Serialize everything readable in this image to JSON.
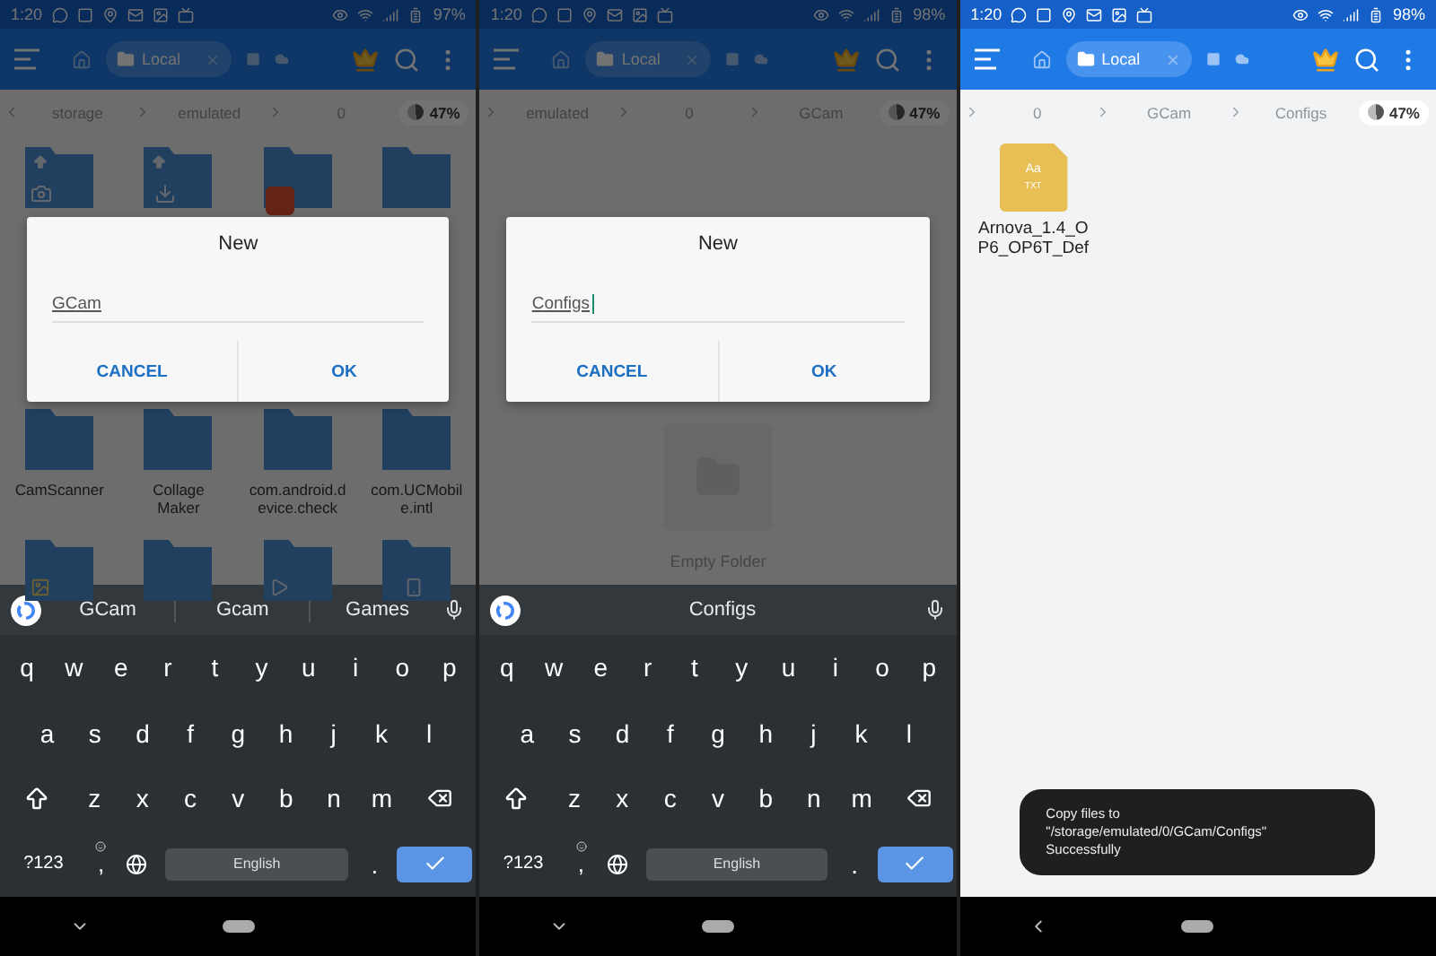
{
  "screens": [
    {
      "dimmed": true,
      "status_bar": {
        "time": "1:20",
        "battery": "97%"
      },
      "app_bar": {
        "tab": "Local"
      },
      "breadcrumbs": [
        "storage",
        "emulated",
        "0"
      ],
      "storage": "47%",
      "content": {
        "kind": "grid",
        "items": [
          {
            "kind": "camera"
          },
          {
            "kind": "download"
          },
          {
            "kind": "app"
          },
          {
            "kind": "plain"
          },
          {
            "kind": "plain",
            "name": "CamScanner"
          },
          {
            "kind": "plain",
            "name": "Collage Maker"
          },
          {
            "kind": "plain",
            "name": "com.android.device.check"
          },
          {
            "kind": "plain",
            "name": "com.UCMobile.intl"
          },
          {
            "kind": "photo"
          },
          {
            "kind": "plain"
          },
          {
            "kind": "video"
          },
          {
            "kind": "phone"
          }
        ]
      },
      "dialog": {
        "title": "New",
        "value": "GCam",
        "cursor": false,
        "buttons": [
          "CANCEL",
          "OK"
        ]
      },
      "keyboard": {
        "suggestions": [
          "GCam",
          "Gcam",
          "Games"
        ],
        "rows": [
          [
            "q",
            "w",
            "e",
            "r",
            "t",
            "y",
            "u",
            "i",
            "o",
            "p"
          ],
          [
            "a",
            "s",
            "d",
            "f",
            "g",
            "h",
            "j",
            "k",
            "l"
          ],
          [
            "z",
            "x",
            "c",
            "v",
            "b",
            "n",
            "m"
          ]
        ],
        "symbols": "?123",
        "comma": ",",
        "space": "English",
        "period": "."
      }
    },
    {
      "dimmed": true,
      "status_bar": {
        "time": "1:20",
        "battery": "98%"
      },
      "app_bar": {
        "tab": "Local"
      },
      "breadcrumbs": [
        "emulated",
        "0",
        "GCam"
      ],
      "storage": "47%",
      "content": {
        "kind": "empty",
        "message": "Empty Folder"
      },
      "dialog": {
        "title": "New",
        "value": "Configs",
        "cursor": true,
        "buttons": [
          "CANCEL",
          "OK"
        ]
      },
      "keyboard": {
        "suggestions": [
          "Configs"
        ],
        "rows": [
          [
            "q",
            "w",
            "e",
            "r",
            "t",
            "y",
            "u",
            "i",
            "o",
            "p"
          ],
          [
            "a",
            "s",
            "d",
            "f",
            "g",
            "h",
            "j",
            "k",
            "l"
          ],
          [
            "z",
            "x",
            "c",
            "v",
            "b",
            "n",
            "m"
          ]
        ],
        "symbols": "?123",
        "comma": ",",
        "space": "English",
        "period": "."
      }
    },
    {
      "dimmed": false,
      "status_bar": {
        "time": "1:20",
        "battery": "98%"
      },
      "app_bar": {
        "tab": "Local"
      },
      "breadcrumbs": [
        "0",
        "GCam",
        "Configs"
      ],
      "storage": "47%",
      "content": {
        "kind": "files",
        "items": [
          {
            "kind": "txt",
            "name": "Arnova_1.4_OP6_OP6T_Def",
            "icon_text": [
              "Aa",
              "TXT"
            ]
          }
        ]
      },
      "toast": "Copy files to \"/storage/emulated/0/GCam/Configs\" Successfully"
    }
  ]
}
